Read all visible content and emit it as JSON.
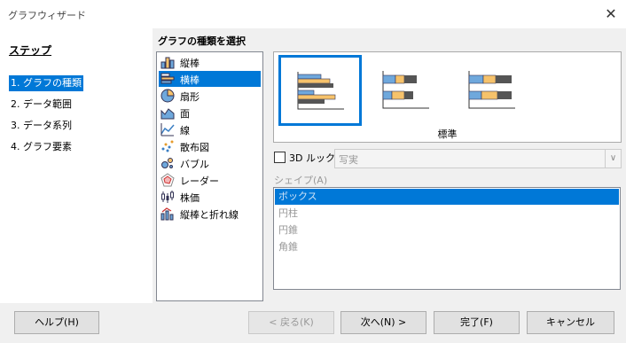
{
  "window": {
    "title": "グラフウィザード"
  },
  "steps": {
    "header": "ステップ",
    "items": [
      {
        "label": "1. グラフの種類",
        "selected": true
      },
      {
        "label": "2. データ範囲",
        "selected": false
      },
      {
        "label": "3. データ系列",
        "selected": false
      },
      {
        "label": "4. グラフ要素",
        "selected": false
      }
    ]
  },
  "chart_type": {
    "title": "グラフの種類を選択",
    "types": [
      {
        "label": "縦棒",
        "icon": "column-chart-icon",
        "selected": false
      },
      {
        "label": "横棒",
        "icon": "bar-chart-icon",
        "selected": true
      },
      {
        "label": "扇形",
        "icon": "pie-chart-icon",
        "selected": false
      },
      {
        "label": "面",
        "icon": "area-chart-icon",
        "selected": false
      },
      {
        "label": "線",
        "icon": "line-chart-icon",
        "selected": false
      },
      {
        "label": "散布図",
        "icon": "scatter-chart-icon",
        "selected": false
      },
      {
        "label": "バブル",
        "icon": "bubble-chart-icon",
        "selected": false
      },
      {
        "label": "レーダー",
        "icon": "radar-chart-icon",
        "selected": false
      },
      {
        "label": "株価",
        "icon": "stock-chart-icon",
        "selected": false
      },
      {
        "label": "縦棒と折れ線",
        "icon": "column-line-chart-icon",
        "selected": false
      }
    ],
    "variant_label": "標準",
    "variants": [
      {
        "icon": "bar-normal-icon",
        "selected": true
      },
      {
        "icon": "bar-stacked-icon",
        "selected": false
      },
      {
        "icon": "bar-percent-stacked-icon",
        "selected": false
      }
    ],
    "look3d": {
      "label": "3D ルック",
      "checked": false,
      "value": "写実"
    },
    "shape": {
      "label": "シェイプ(A)",
      "items": [
        {
          "label": "ボックス",
          "selected": true
        },
        {
          "label": "円柱",
          "selected": false
        },
        {
          "label": "円錐",
          "selected": false
        },
        {
          "label": "角錐",
          "selected": false
        }
      ]
    }
  },
  "buttons": {
    "help": "ヘルプ(H)",
    "back": "< 戻る(K)",
    "next": "次へ(N) >",
    "finish": "完了(F)",
    "cancel": "キャンセル"
  },
  "colors": {
    "accent": "#0078d7",
    "bar_blue": "#6fa8dc",
    "bar_orange": "#f6c26b",
    "bar_gray": "#555555"
  }
}
